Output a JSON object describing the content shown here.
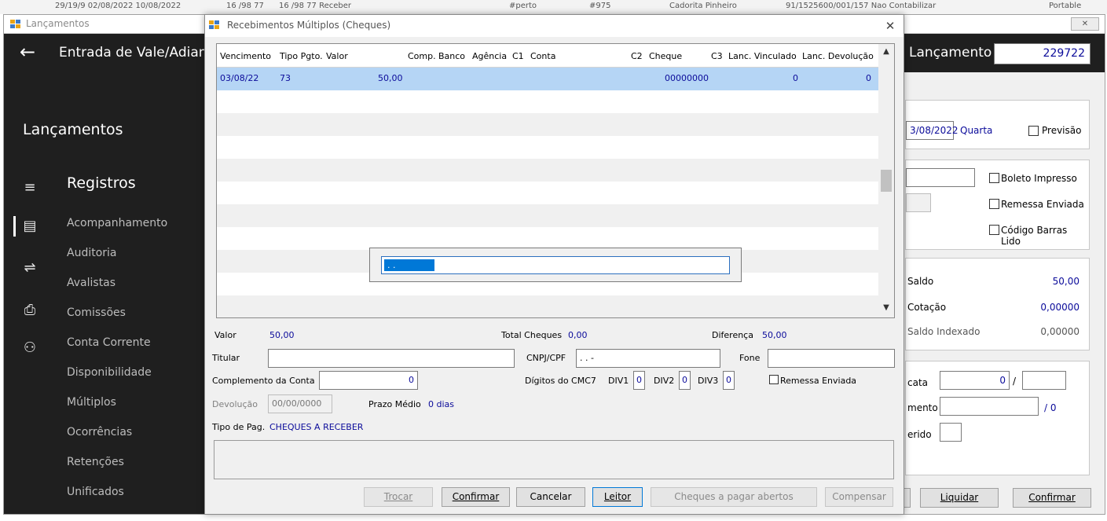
{
  "background_strip": {
    "texts": [
      "29/19/9 02/08/2022 10/08/2022",
      "16 /98 77",
      "16 /98 77 Receber",
      "#perto",
      "#975",
      "Cadorita Pinheiro",
      "91/1525600/001/157 Nao Contabilizar",
      "Portable"
    ]
  },
  "parent": {
    "title": "Lançamentos",
    "close_icon": "close-icon",
    "header": {
      "title": "Entrada de Vale/Adianta",
      "lanc_label": "Lançamento",
      "lanc_number": "229722"
    },
    "sidebar": {
      "heading": "Lançamentos",
      "section": "Registros",
      "items": [
        {
          "label": "Acompanhamento"
        },
        {
          "label": "Auditoria"
        },
        {
          "label": "Avalistas"
        },
        {
          "label": "Comissões"
        },
        {
          "label": "Conta Corrente"
        },
        {
          "label": "Disponibilidade"
        },
        {
          "label": "Múltiplos"
        },
        {
          "label": "Ocorrências"
        },
        {
          "label": "Retenções"
        },
        {
          "label": "Unificados"
        }
      ],
      "icons": [
        "menu-icon",
        "document-icon",
        "transfer-icon",
        "print-icon",
        "network-icon"
      ]
    },
    "right": {
      "date": "3/08/2022",
      "weekday": "Quarta",
      "previsao_label": "Previsão",
      "boleto_label": "Boleto Impresso",
      "remessa_label": "Remessa Enviada",
      "codigo_label": "Código Barras Lido",
      "saldo_label": "Saldo",
      "saldo_value": "50,00",
      "cotacao_label": "Cotação",
      "cotacao_value": "0,00000",
      "saldo_idx_label": "Saldo Indexado",
      "saldo_idx_value": "0,00000",
      "cata_label": "cata",
      "cata_value": "0",
      "slash": "/",
      "mento_label": "mento",
      "mento_value": "/ 0",
      "erido_label": "erido",
      "liquidar": "Liquidar",
      "confirmar": "Confirmar"
    }
  },
  "dialog": {
    "title": "Recebimentos Múltiplos (Cheques)",
    "close": "✕",
    "columns": [
      "Vencimento",
      "Tipo Pgto.",
      "Valor",
      "Comp.",
      "Banco",
      "Agência",
      "C1",
      "Conta",
      "C2",
      "Cheque",
      "C3",
      "Lanc. Vinculado",
      "Lanc. Devolução"
    ],
    "rows": [
      {
        "vencimento": "03/08/22",
        "tipo": "73",
        "valor": "50,00",
        "cheque": "00000000",
        "vinculado": "0",
        "devolucao": "0"
      }
    ],
    "popup_value": "  .    .",
    "labels": {
      "valor": "Valor",
      "valor_value": "50,00",
      "total_cheques": "Total Cheques",
      "total_cheques_value": "0,00",
      "diferenca": "Diferença",
      "diferenca_value": "50,00",
      "titular": "Titular",
      "cnpj": "CNPJ/CPF",
      "cnpj_value": " .   .   -",
      "fone": "Fone",
      "complemento": "Complemento da Conta",
      "complemento_value": "0",
      "digitos": "Dígitos do CMC7",
      "div1": "DIV1",
      "div1_value": "0",
      "div2": "DIV2",
      "div2_value": "0",
      "div3": "DIV3",
      "div3_value": "0",
      "remessa": "Remessa Enviada",
      "devolucao": "Devolução",
      "devolucao_value": "00/00/0000",
      "prazo": "Prazo Médio",
      "prazo_value": "0 dias",
      "tipo_pag": "Tipo de Pag.",
      "tipo_pag_value": "CHEQUES A RECEBER"
    },
    "buttons": {
      "trocar": "Trocar",
      "confirmar": "Confirmar",
      "cancelar": "Cancelar",
      "leitor": "Leitor",
      "cheques_abertos": "Cheques a pagar abertos",
      "compensar": "Compensar"
    }
  }
}
